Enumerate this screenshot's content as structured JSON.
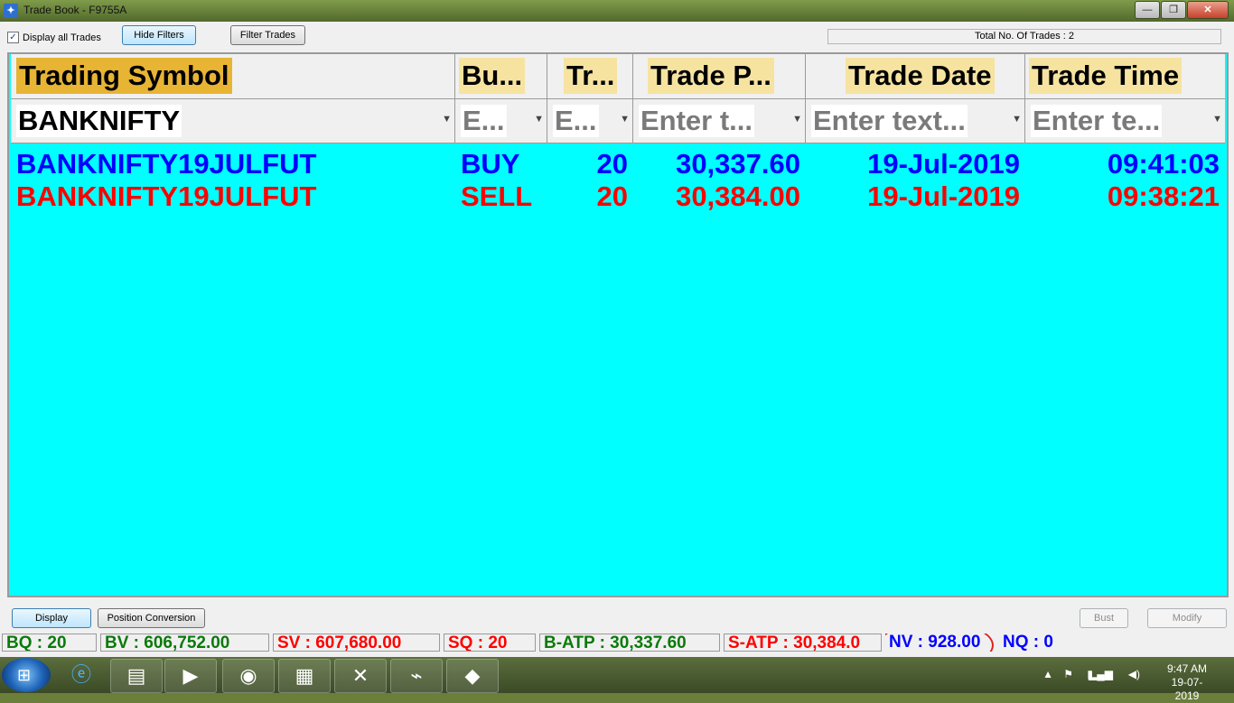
{
  "window": {
    "title": "Trade Book - F9755A",
    "min": "—",
    "max": "❐",
    "close": "✕"
  },
  "toolbar": {
    "display_all_label": "Display all Trades",
    "display_all_checked": "✓",
    "hide_filters": "Hide Filters",
    "filter_trades": "Filter Trades",
    "total_trades": "Total No. Of Trades : 2"
  },
  "grid": {
    "columns": [
      {
        "label": "Trading Symbol",
        "filter": "BANKNIFTY"
      },
      {
        "label": "Bu...",
        "filter": "E..."
      },
      {
        "label": "Tr...",
        "filter": "E..."
      },
      {
        "label": "Trade P...",
        "filter": "Enter t..."
      },
      {
        "label": "Trade Date",
        "filter": "Enter text..."
      },
      {
        "label": "Trade Time",
        "filter": "Enter te..."
      }
    ],
    "header_color": "#e7b434",
    "filter_icon": "funnel-icon",
    "rows": [
      {
        "symbol": "BANKNIFTY19JULFUT",
        "side": "BUY",
        "qty": "20",
        "price": "30,337.60",
        "date": "19-Jul-2019",
        "time": "09:41:03",
        "color": "#0000ff"
      },
      {
        "symbol": "BANKNIFTY19JULFUT",
        "side": "SELL",
        "qty": "20",
        "price": "30,384.00",
        "date": "19-Jul-2019",
        "time": "09:38:21",
        "color": "#ff0000"
      }
    ],
    "background": "#00ffff"
  },
  "buttons": {
    "display": "Display",
    "position_conversion": "Position Conversion",
    "bust": "Bust",
    "modify": "Modify"
  },
  "status": {
    "bq": "BQ : 20",
    "bv": "BV : 606,752.00",
    "sv": "SV : 607,680.00",
    "sq": "SQ : 20",
    "batp": "B-ATP : 30,337.60",
    "satp": "S-ATP : 30,384.0",
    "nv": "NV : 928.00",
    "nq": "NQ : 0",
    "green": "#0a7a0a",
    "red": "#ff0000",
    "blue": "#0000ff"
  },
  "taskbar": {
    "time": "9:47 AM",
    "date": "19-07-2019",
    "apps": [
      "internet-explorer-icon",
      "file-explorer-icon",
      "media-player-icon",
      "chrome-icon",
      "calculator-icon",
      "excel-icon",
      "pdf-reader-icon",
      "trading-terminal-icon"
    ]
  }
}
